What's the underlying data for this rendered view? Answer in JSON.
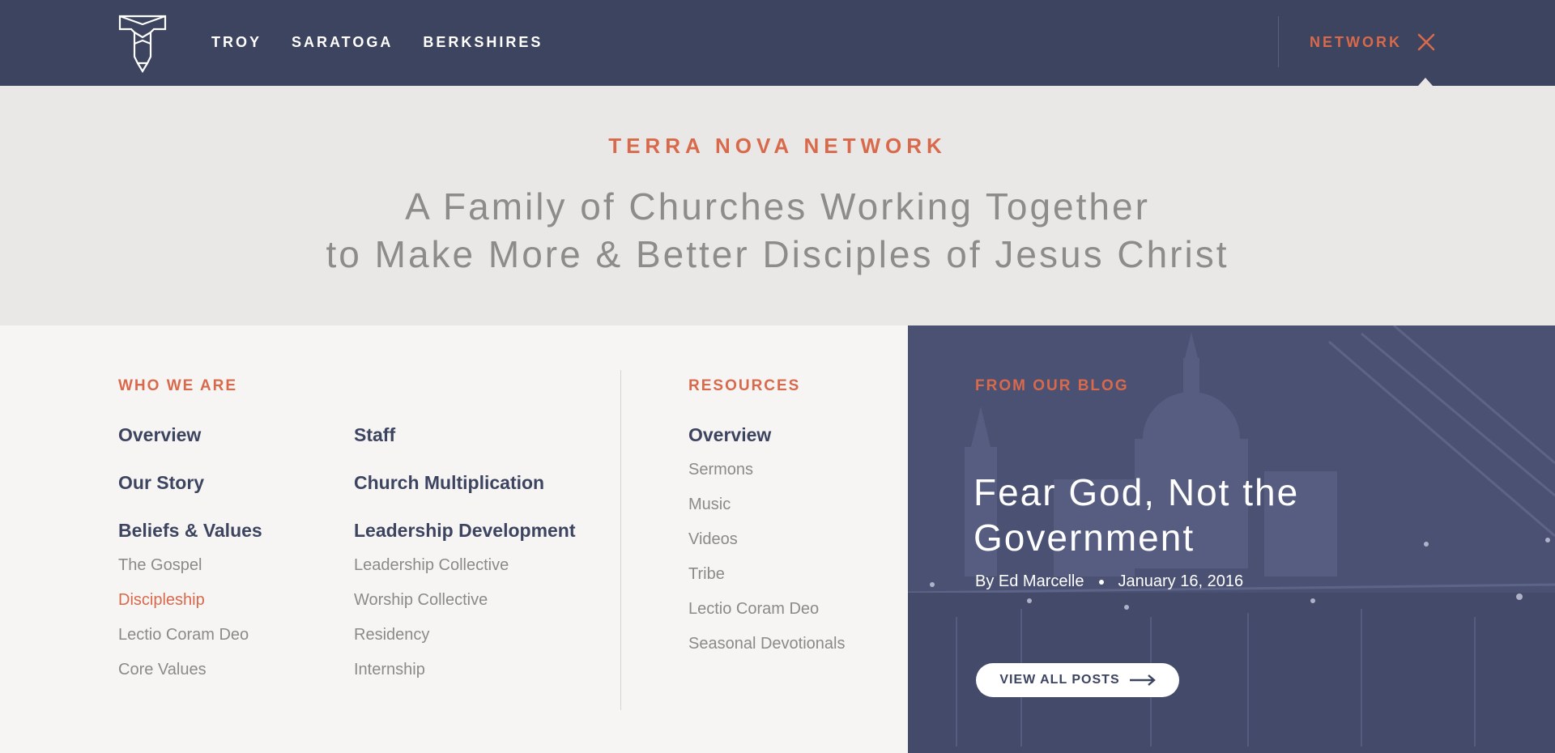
{
  "nav": {
    "links": [
      {
        "label": "TROY"
      },
      {
        "label": "SARATOGA"
      },
      {
        "label": "BERKSHIRES"
      }
    ],
    "network_label": "NETWORK"
  },
  "hero": {
    "eyebrow": "TERRA NOVA NETWORK",
    "line1": "A Family of Churches Working Together",
    "line2": "to Make More & Better Disciples of Jesus Christ"
  },
  "who_we_are": {
    "heading": "WHO WE ARE",
    "col1": {
      "primary": [
        "Overview",
        "Our Story",
        "Beliefs & Values"
      ],
      "secondary": [
        "The Gospel",
        "Discipleship",
        "Lectio Coram Deo",
        "Core Values"
      ]
    },
    "col2": {
      "primary": [
        "Staff",
        "Church Multiplication",
        "Leadership Development"
      ],
      "secondary": [
        "Leadership Collective",
        "Worship Collective",
        "Residency",
        "Internship"
      ]
    }
  },
  "resources": {
    "heading": "RESOURCES",
    "primary": [
      "Overview"
    ],
    "secondary": [
      "Sermons",
      "Music",
      "Videos",
      "Tribe",
      "Lectio Coram Deo",
      "Seasonal Devotionals"
    ]
  },
  "blog": {
    "heading": "FROM OUR BLOG",
    "title_line1": "Fear God, Not the",
    "title_line2": "Government",
    "author": "By Ed Marcelle",
    "date": "January 16, 2016",
    "button_label": "VIEW ALL POSTS"
  },
  "colors": {
    "navy": "#3d4460",
    "accent": "#d9694b",
    "hero_bg": "#eae8e6",
    "panel_bg": "#f6f5f3"
  }
}
